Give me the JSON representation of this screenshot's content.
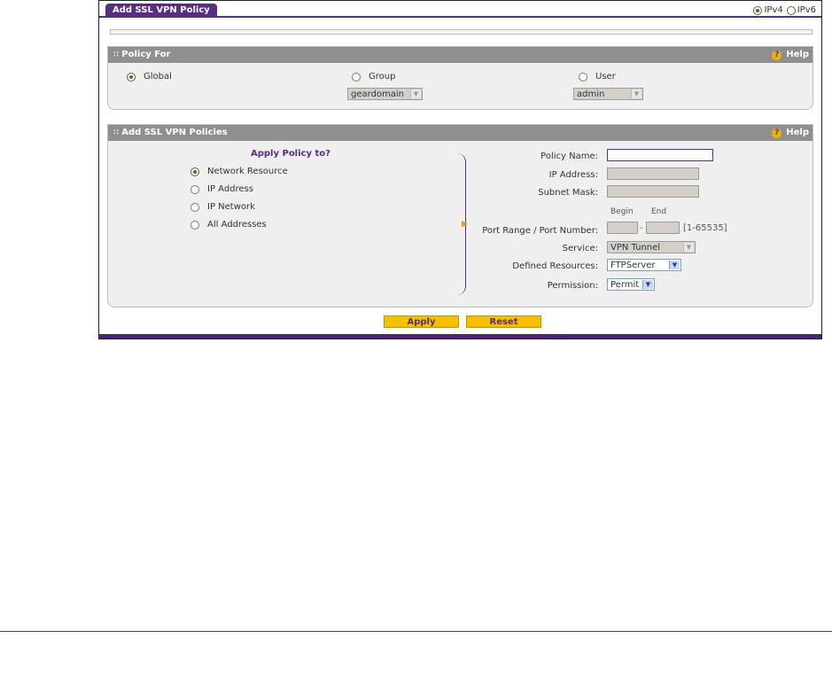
{
  "tab": {
    "title": "Add SSL VPN Policy"
  },
  "ip_version": {
    "ipv4_label": "IPv4",
    "ipv6_label": "IPv6",
    "selected": "IPv4"
  },
  "policy_for": {
    "title": "Policy For",
    "help_label": "Help",
    "global_label": "Global",
    "group_label": "Group",
    "user_label": "User",
    "selected": "Global",
    "group_value": "geardomain",
    "user_value": "admin"
  },
  "policies": {
    "title": "Add SSL VPN Policies",
    "help_label": "Help",
    "apply_to_heading": "Apply Policy to?",
    "options": [
      "Network Resource",
      "IP Address",
      "IP Network",
      "All Addresses"
    ],
    "selected": "Network Resource",
    "policy_name_label": "Policy Name:",
    "policy_name_value": "",
    "ip_address_label": "IP Address:",
    "subnet_mask_label": "Subnet Mask:",
    "begin_label": "Begin",
    "end_label": "End",
    "port_range_label": "Port Range / Port Number:",
    "port_range_hint": "[1-65535]",
    "port_dash": "-",
    "service_label": "Service:",
    "service_value": "VPN Tunnel",
    "defined_resources_label": "Defined Resources:",
    "defined_resources_value": "FTPServer",
    "permission_label": "Permission:",
    "permission_value": "Permit"
  },
  "buttons": {
    "apply": "Apply",
    "reset": "Reset"
  },
  "colors": {
    "brand": "#5a2d82",
    "button": "#f5c000",
    "panel_header": "#8f8f8f"
  }
}
